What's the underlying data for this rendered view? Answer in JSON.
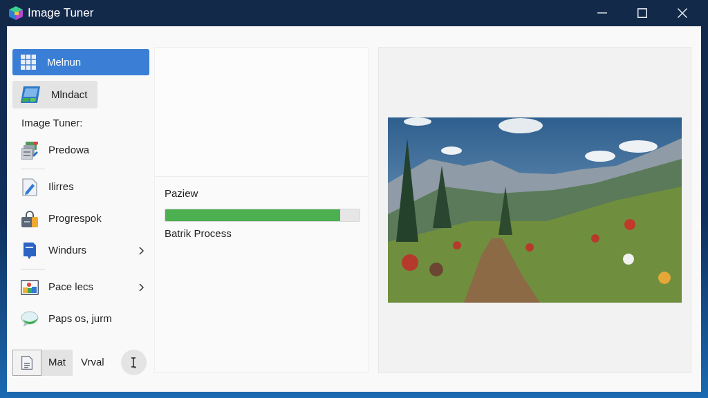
{
  "window": {
    "title": "Image Tuner"
  },
  "sidebar": {
    "top_items": [
      {
        "label": "Melnun",
        "selected": true,
        "highlighted": false
      },
      {
        "label": "Mlndact",
        "selected": false,
        "highlighted": true
      }
    ],
    "section_title": "Image Tuner:",
    "groups": [
      {
        "items": [
          {
            "label": "Predowa",
            "submenu": false
          }
        ]
      },
      {
        "items": [
          {
            "label": "Ilirres",
            "submenu": false
          },
          {
            "label": "Progrespok",
            "submenu": false
          },
          {
            "label": "Windurs",
            "submenu": true
          }
        ]
      },
      {
        "items": [
          {
            "label": "Pace lecs",
            "submenu": true
          },
          {
            "label": "Paps os, jurm",
            "submenu": false
          }
        ]
      }
    ]
  },
  "bottom_bar": {
    "mode_buttons": [
      {
        "label": "Mat",
        "selected": true
      },
      {
        "label": "Vrval",
        "selected": false
      }
    ]
  },
  "preview": {
    "label": "Paziew",
    "progress": {
      "level": 0.9
    },
    "status": "Batrik Process"
  }
}
